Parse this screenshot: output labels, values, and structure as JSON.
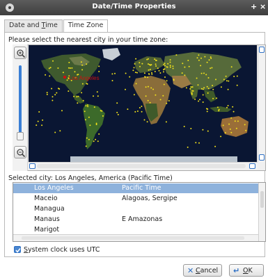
{
  "window": {
    "title": "Date/Time Properties",
    "controls": [
      "+",
      "×"
    ]
  },
  "tabs": [
    {
      "label_pre": "Date and ",
      "label_ul": "T",
      "label_post": "ime",
      "active": false
    },
    {
      "label": "Time Zone",
      "active": true
    }
  ],
  "time_zone": {
    "instruction": "Please select the nearest city in your time zone:",
    "map_marker_label": "Los Angeles",
    "selected_city_text": "Selected city: Los Angeles, America (Pacific Time)",
    "cities": [
      {
        "city": "Los Angeles",
        "zone": "Pacific Time",
        "selected": true
      },
      {
        "city": "Maceio",
        "zone": "Alagoas, Sergipe",
        "selected": false
      },
      {
        "city": "Managua",
        "zone": "",
        "selected": false
      },
      {
        "city": "Manaus",
        "zone": "E Amazonas",
        "selected": false
      },
      {
        "city": "Marigot",
        "zone": "",
        "selected": false
      }
    ],
    "utc_checkbox": {
      "mnemonic": "S",
      "rest": "ystem clock uses UTC",
      "checked": true
    }
  },
  "buttons": {
    "cancel": {
      "mnemonic": "C",
      "rest": "ancel"
    },
    "ok": {
      "mnemonic": "O",
      "rest": "K"
    }
  },
  "colors": {
    "selection": "#8eb2dc",
    "accent": "#2d6fc4",
    "city_dot": "#f2e21a",
    "marker": "#cc1111"
  }
}
